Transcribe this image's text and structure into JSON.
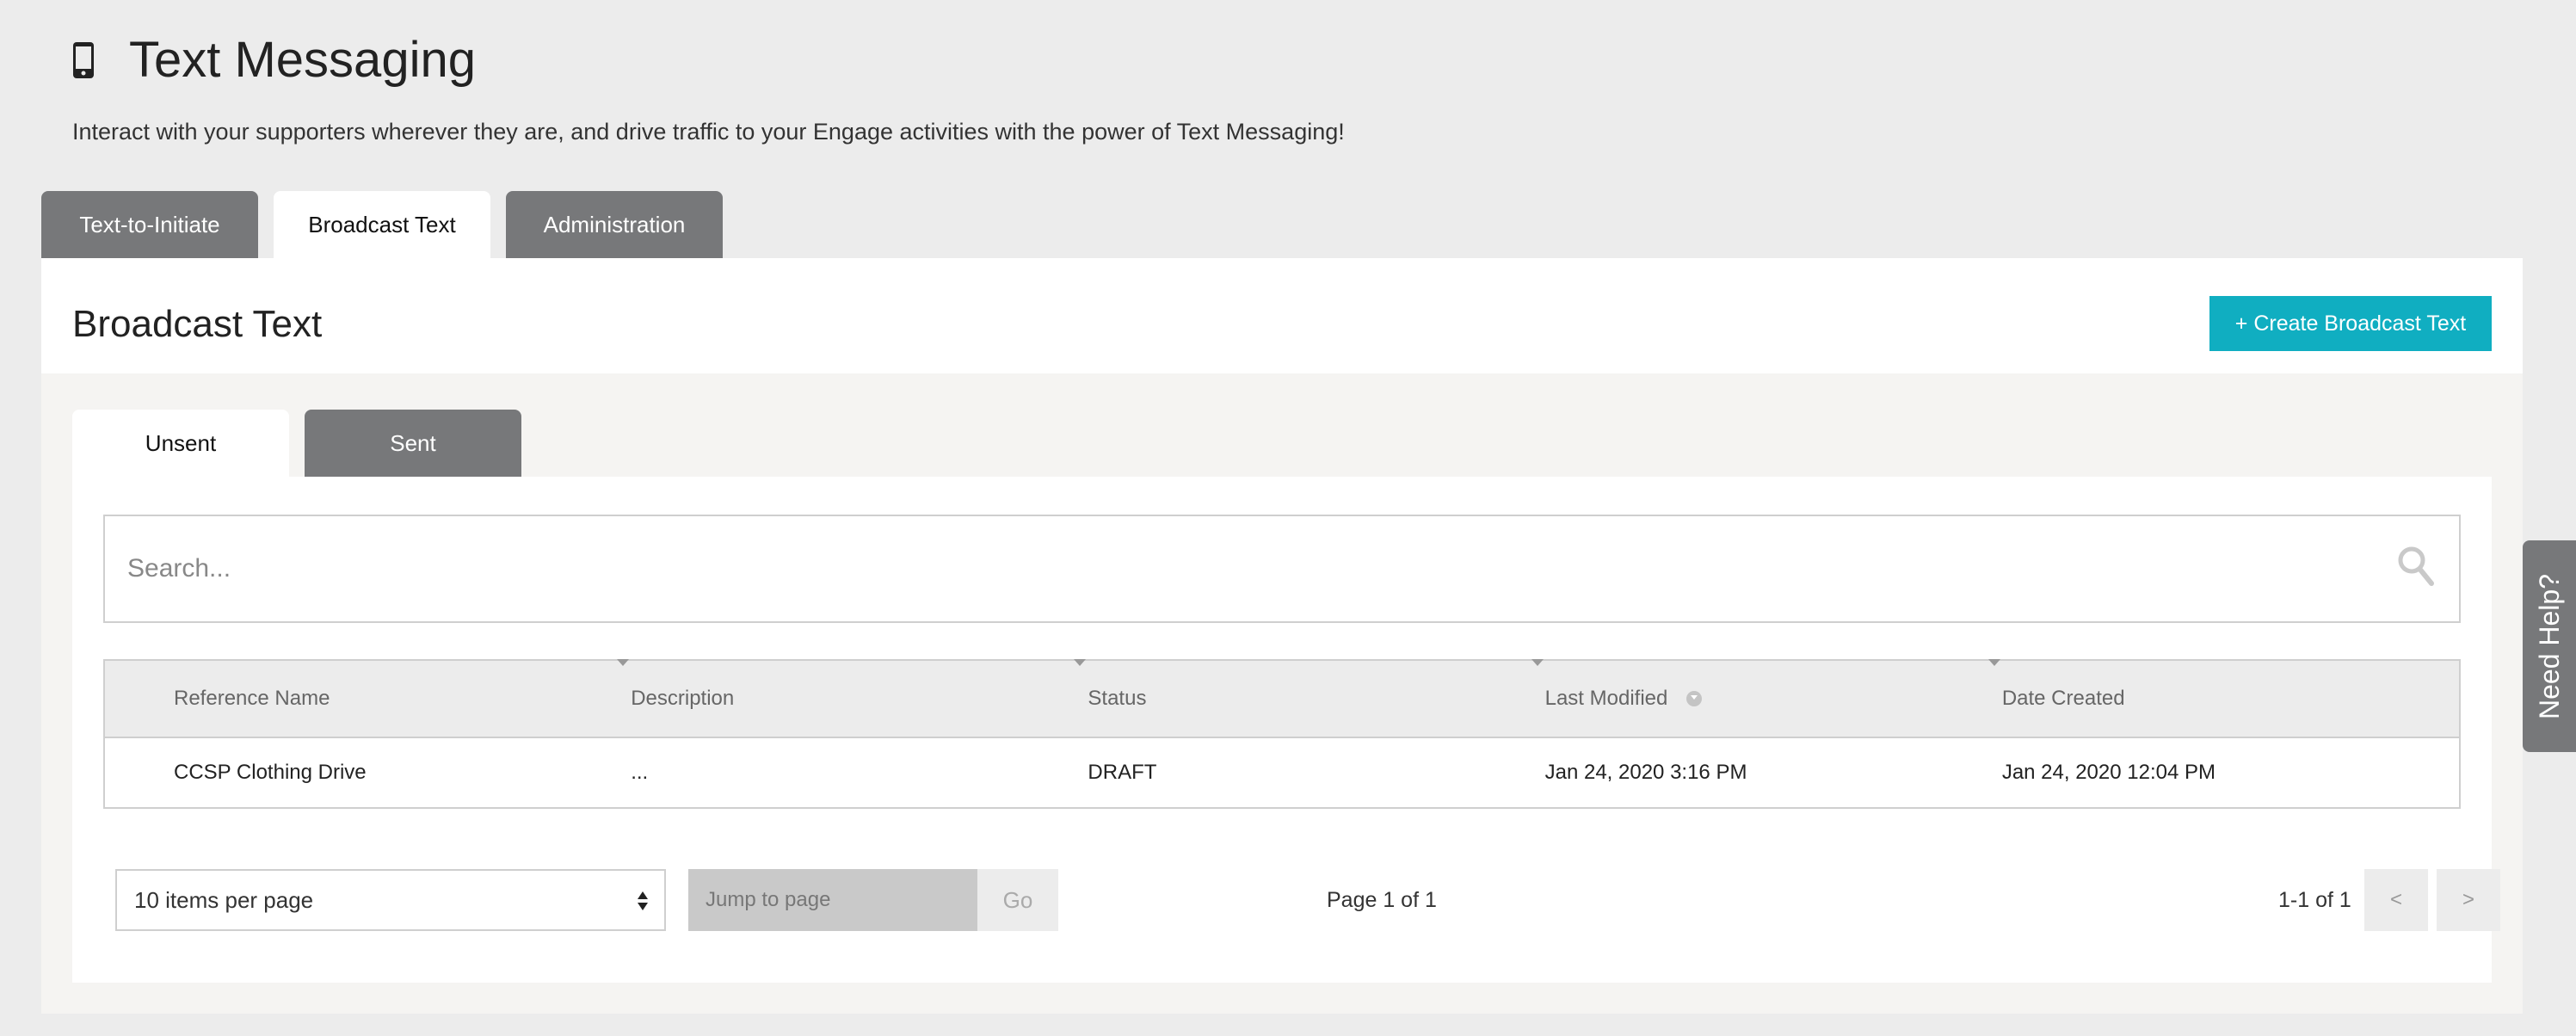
{
  "header": {
    "icon": "mobile-phone-icon",
    "title": "Text Messaging",
    "subtitle": "Interact with your supporters wherever they are, and drive traffic to your Engage activities with the power of Text Messaging!"
  },
  "main_tabs": [
    {
      "label": "Text-to-Initiate",
      "active": false
    },
    {
      "label": "Broadcast Text",
      "active": true
    },
    {
      "label": "Administration",
      "active": false
    }
  ],
  "panel": {
    "title": "Broadcast Text",
    "create_button": "+ Create Broadcast Text"
  },
  "sub_tabs": [
    {
      "label": "Unsent",
      "active": true
    },
    {
      "label": "Sent",
      "active": false
    }
  ],
  "search": {
    "placeholder": "Search...",
    "icon": "search-icon"
  },
  "table": {
    "columns": [
      "Reference Name",
      "Description",
      "Status",
      "Last Modified",
      "Date Created"
    ],
    "rows": [
      [
        "CCSP Clothing Drive",
        "...",
        "DRAFT",
        "Jan 24, 2020 3:16 PM",
        "Jan 24, 2020 12:04 PM"
      ]
    ]
  },
  "pagination": {
    "per_page": "10 items per page",
    "jump_placeholder": "Jump to page",
    "go_label": "Go",
    "page_label": "Page 1 of 1",
    "range_label": "1-1 of 1",
    "prev_label": "<",
    "next_label": ">"
  },
  "help": {
    "label": "Need Help?"
  },
  "colors": {
    "accent": "#10aec1",
    "tab_inactive": "#77787a",
    "background": "#ececec"
  }
}
